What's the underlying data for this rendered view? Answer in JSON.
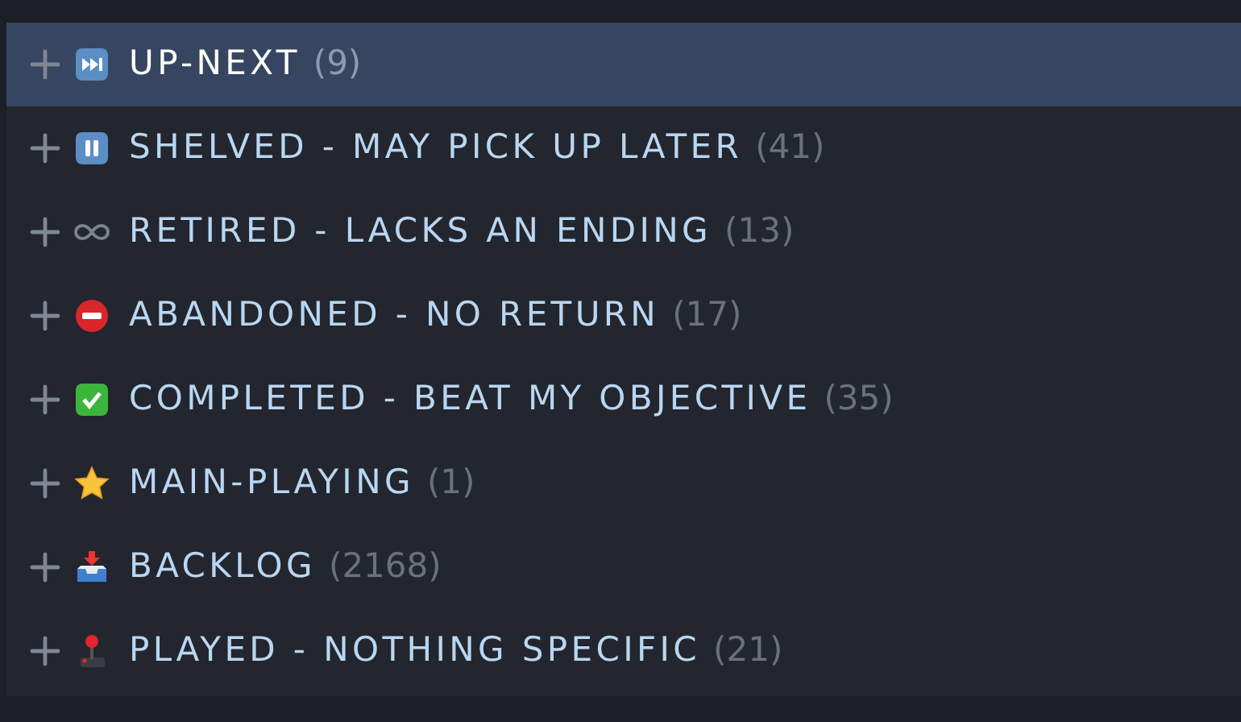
{
  "collections": [
    {
      "kind": "next",
      "name": "UP-NEXT",
      "count": "(9)",
      "selected": true
    },
    {
      "kind": "pause",
      "name": "SHELVED - MAY PICK UP LATER",
      "count": "(41)",
      "selected": false
    },
    {
      "kind": "infinity",
      "name": "RETIRED - LACKS AN ENDING",
      "count": "(13)",
      "selected": false
    },
    {
      "kind": "noentry",
      "name": "ABANDONED - NO RETURN",
      "count": "(17)",
      "selected": false
    },
    {
      "kind": "check",
      "name": "COMPLETED - BEAT MY OBJECTIVE",
      "count": "(35)",
      "selected": false
    },
    {
      "kind": "star",
      "name": "MAIN-PLAYING",
      "count": "(1)",
      "selected": false
    },
    {
      "kind": "inbox",
      "name": "BACKLOG",
      "count": "(2168)",
      "selected": false
    },
    {
      "kind": "joystick",
      "name": "PLAYED - NOTHING SPECIFIC",
      "count": "(21)",
      "selected": false
    }
  ]
}
